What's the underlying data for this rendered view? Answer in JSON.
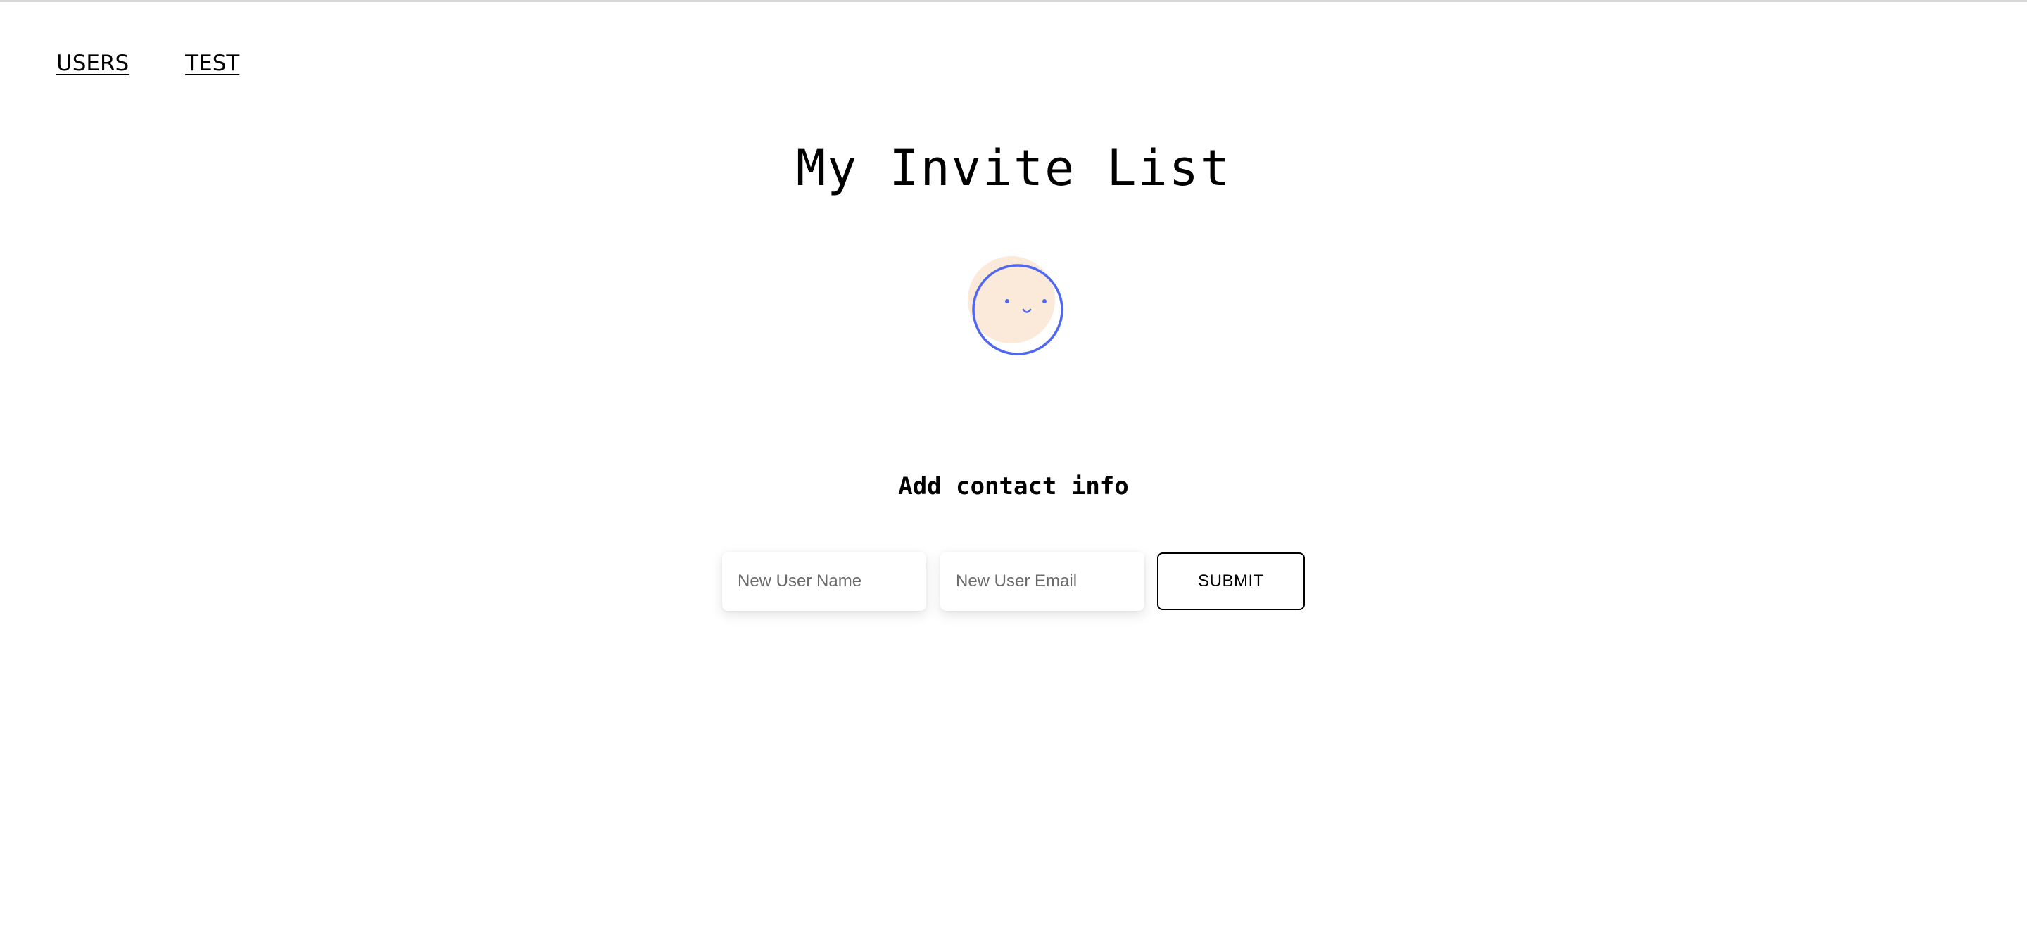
{
  "nav": {
    "items": [
      {
        "label": "USERS"
      },
      {
        "label": "TEST"
      }
    ]
  },
  "page_title": "My Invite List",
  "avatar": {
    "icon": "smiley-face-icon",
    "fill_color": "#fbe9da",
    "stroke_color": "#5067f0"
  },
  "form": {
    "heading": "Add contact info",
    "name_input": {
      "placeholder": "New User Name",
      "value": ""
    },
    "email_input": {
      "placeholder": "New User Email",
      "value": ""
    },
    "submit_label": "SUBMIT"
  }
}
